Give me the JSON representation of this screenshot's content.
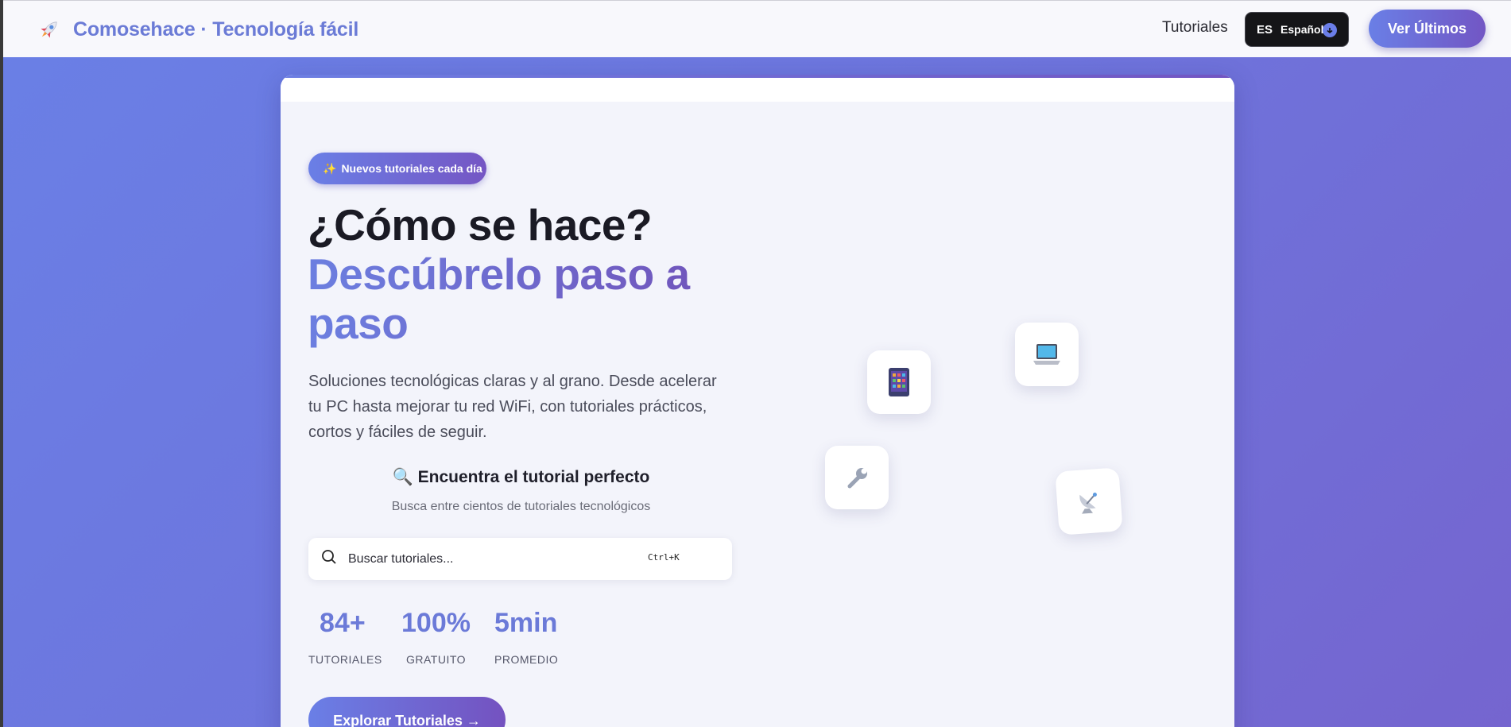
{
  "header": {
    "brand": "Comosehace · Tecnología fácil",
    "nav_tutorials": "Tutoriales",
    "lang_code": "ES",
    "lang_name": "Español",
    "cta": "Ver Últimos"
  },
  "hero": {
    "badge": "Nuevos tutoriales cada día",
    "title": "¿Cómo se hace?",
    "title_accent": "Descúbrelo paso a paso",
    "description": "Soluciones tecnológicas claras y al grano. Desde acelerar tu PC hasta mejorar tu red WiFi, con tutoriales prácticos, cortos y fáciles de seguir.",
    "finder_title": "Encuentra el tutorial perfecto",
    "finder_subtitle": "Busca entre cientos de tutoriales tecnológicos",
    "search_placeholder": "Buscar tutoriales...",
    "search_shortcut": "Ctrl+K",
    "stats": [
      {
        "value": "84+",
        "label": "TUTORIALES"
      },
      {
        "value": "100%",
        "label": "GRATUITO"
      },
      {
        "value": "5min",
        "label": "PROMEDIO"
      }
    ],
    "explore_button": "Explorar Tutoriales →"
  },
  "floating_icons": [
    "tablet-icon",
    "laptop-icon",
    "wrench-icon",
    "satellite-dish-icon"
  ],
  "colors": {
    "accent": "#6b7bd6",
    "accent_gradient_end": "#7256c4",
    "page_bg": "#6e74dc"
  }
}
